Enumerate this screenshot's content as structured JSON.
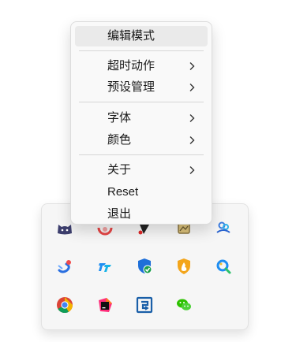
{
  "menu": {
    "items": [
      {
        "label": "编辑模式"
      },
      {
        "label": "超时动作"
      },
      {
        "label": "预设管理"
      },
      {
        "label": "字体"
      },
      {
        "label": "颜色"
      },
      {
        "label": "关于"
      },
      {
        "label": "Reset"
      },
      {
        "label": "退出"
      }
    ]
  },
  "tray": {
    "icons": [
      "cat-icon",
      "red-app-icon",
      "black-app-icon",
      "image-viewer-icon",
      "cloud-sync-icon",
      "translate-icon",
      "tt-app-icon",
      "security-shield-icon",
      "firewall-shield-icon",
      "search-lens-icon",
      "chrome-icon",
      "jetbrains-icon",
      "flashback-icon",
      "wechat-icon"
    ]
  },
  "colors": {
    "menu_bg": "#f9f9f9",
    "hover_bg": "#eaeaea",
    "tray_bg": "#f6f6f6",
    "text": "#1a1a1a"
  }
}
